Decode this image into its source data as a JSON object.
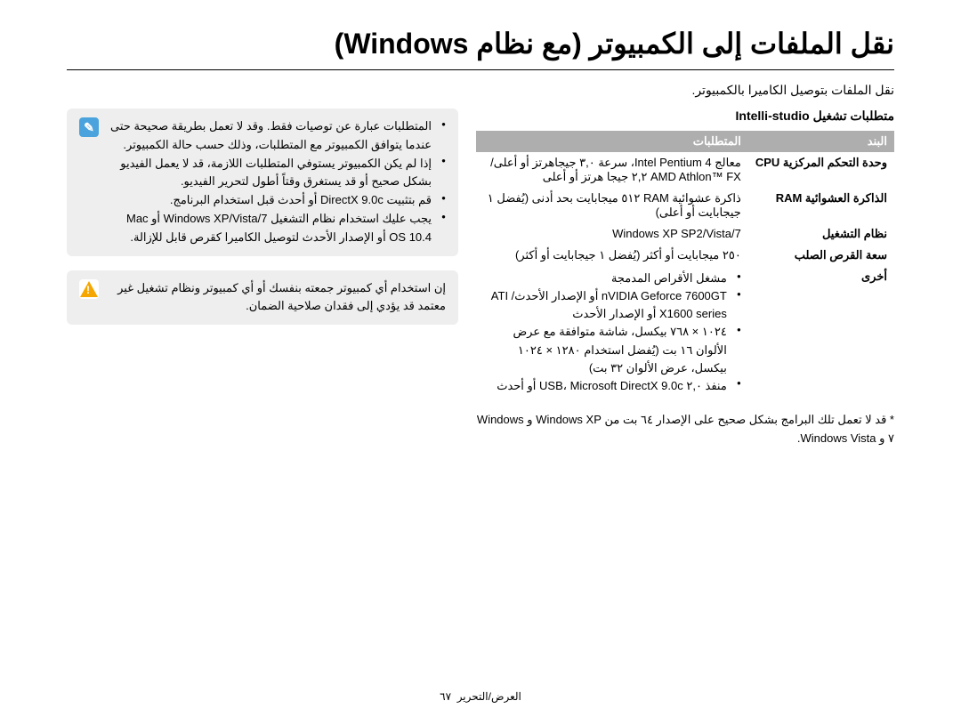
{
  "title": "نقل الملفات إلى الكمبيوتر (مع نظام Windows)",
  "intro": "نقل الملفات بتوصيل الكاميرا بالكمبيوتر.",
  "subheading": "متطلبات تشغيل Intelli-studio",
  "table": {
    "headers": {
      "item": "البند",
      "req": "المتطلبات"
    },
    "rows": [
      {
        "item": "وحدة التحكم المركزية CPU",
        "req": "معالج Intel Pentium 4، سرعة ٣,٠ جيجاهرتز أو أعلى/ AMD Athlon™ FX ٢,٢ جيجا هرتز أو أعلى"
      },
      {
        "item": "الذاكرة العشوائية RAM",
        "req": "ذاكرة عشوائية RAM ٥١٢ ميجابايت بحد أدنى (يُفضل ١ جيجابايت أو أعلى)"
      },
      {
        "item": "نظام التشغيل",
        "req": "Windows XP SP2/Vista/7"
      },
      {
        "item": "سعة القرص الصلب",
        "req": "٢٥٠ ميجابايت أو أكثر (يُفضل ١ جيجابايت أو أكثر)"
      },
      {
        "item": "أخرى",
        "req_list": [
          "مشغل الأقراص المدمجة",
          "nVIDIA Geforce 7600GT أو الإصدار الأحدث/ ATI X1600 series أو الإصدار الأحدث",
          "١٠٢٤ × ٧٦٨ بيكسل، شاشة متوافقة مع عرض الألوان ١٦ بت (يُفضل استخدام ١٢٨٠ × ١٠٢٤ بيكسل، عرض الألوان ٣٢ بت)",
          "منفذ ٢,٠ USB، Microsoft DirectX 9.0c أو أحدث"
        ]
      }
    ]
  },
  "footnote": "* قد لا تعمل تلك البرامج بشكل صحيح على الإصدار ٦٤ بت من Windows XP و Windows ٧ و Windows Vista.",
  "notes": {
    "info_list": [
      "المتطلبات عبارة عن توصيات فقط. وقد لا تعمل بطريقة صحيحة حتى عندما يتوافق الكمبيوتر مع المتطلبات، وذلك حسب حالة الكمبيوتر.",
      "إذا لم يكن الكمبيوتر يستوفي المتطلبات اللازمة، قد لا يعمل الفيديو بشكل صحيح أو قد يستغرق وقتاً أطول لتحرير الفيديو.",
      "قم بتثبيت DirectX 9.0c أو أحدث قبل استخدام البرنامج.",
      "يجب عليك استخدام نظام التشغيل Windows XP/Vista/7 أو Mac OS 10.4 أو الإصدار الأحدث لتوصيل الكاميرا كقرص قابل للإزالة."
    ],
    "warning": "إن استخدام أي كمبيوتر جمعته بنفسك أو أي كمبيوتر ونظام تشغيل غير معتمد قد يؤدي إلى فقدان صلاحية الضمان."
  },
  "footer": {
    "section": "العرض/التحرير",
    "page": "٦٧"
  }
}
